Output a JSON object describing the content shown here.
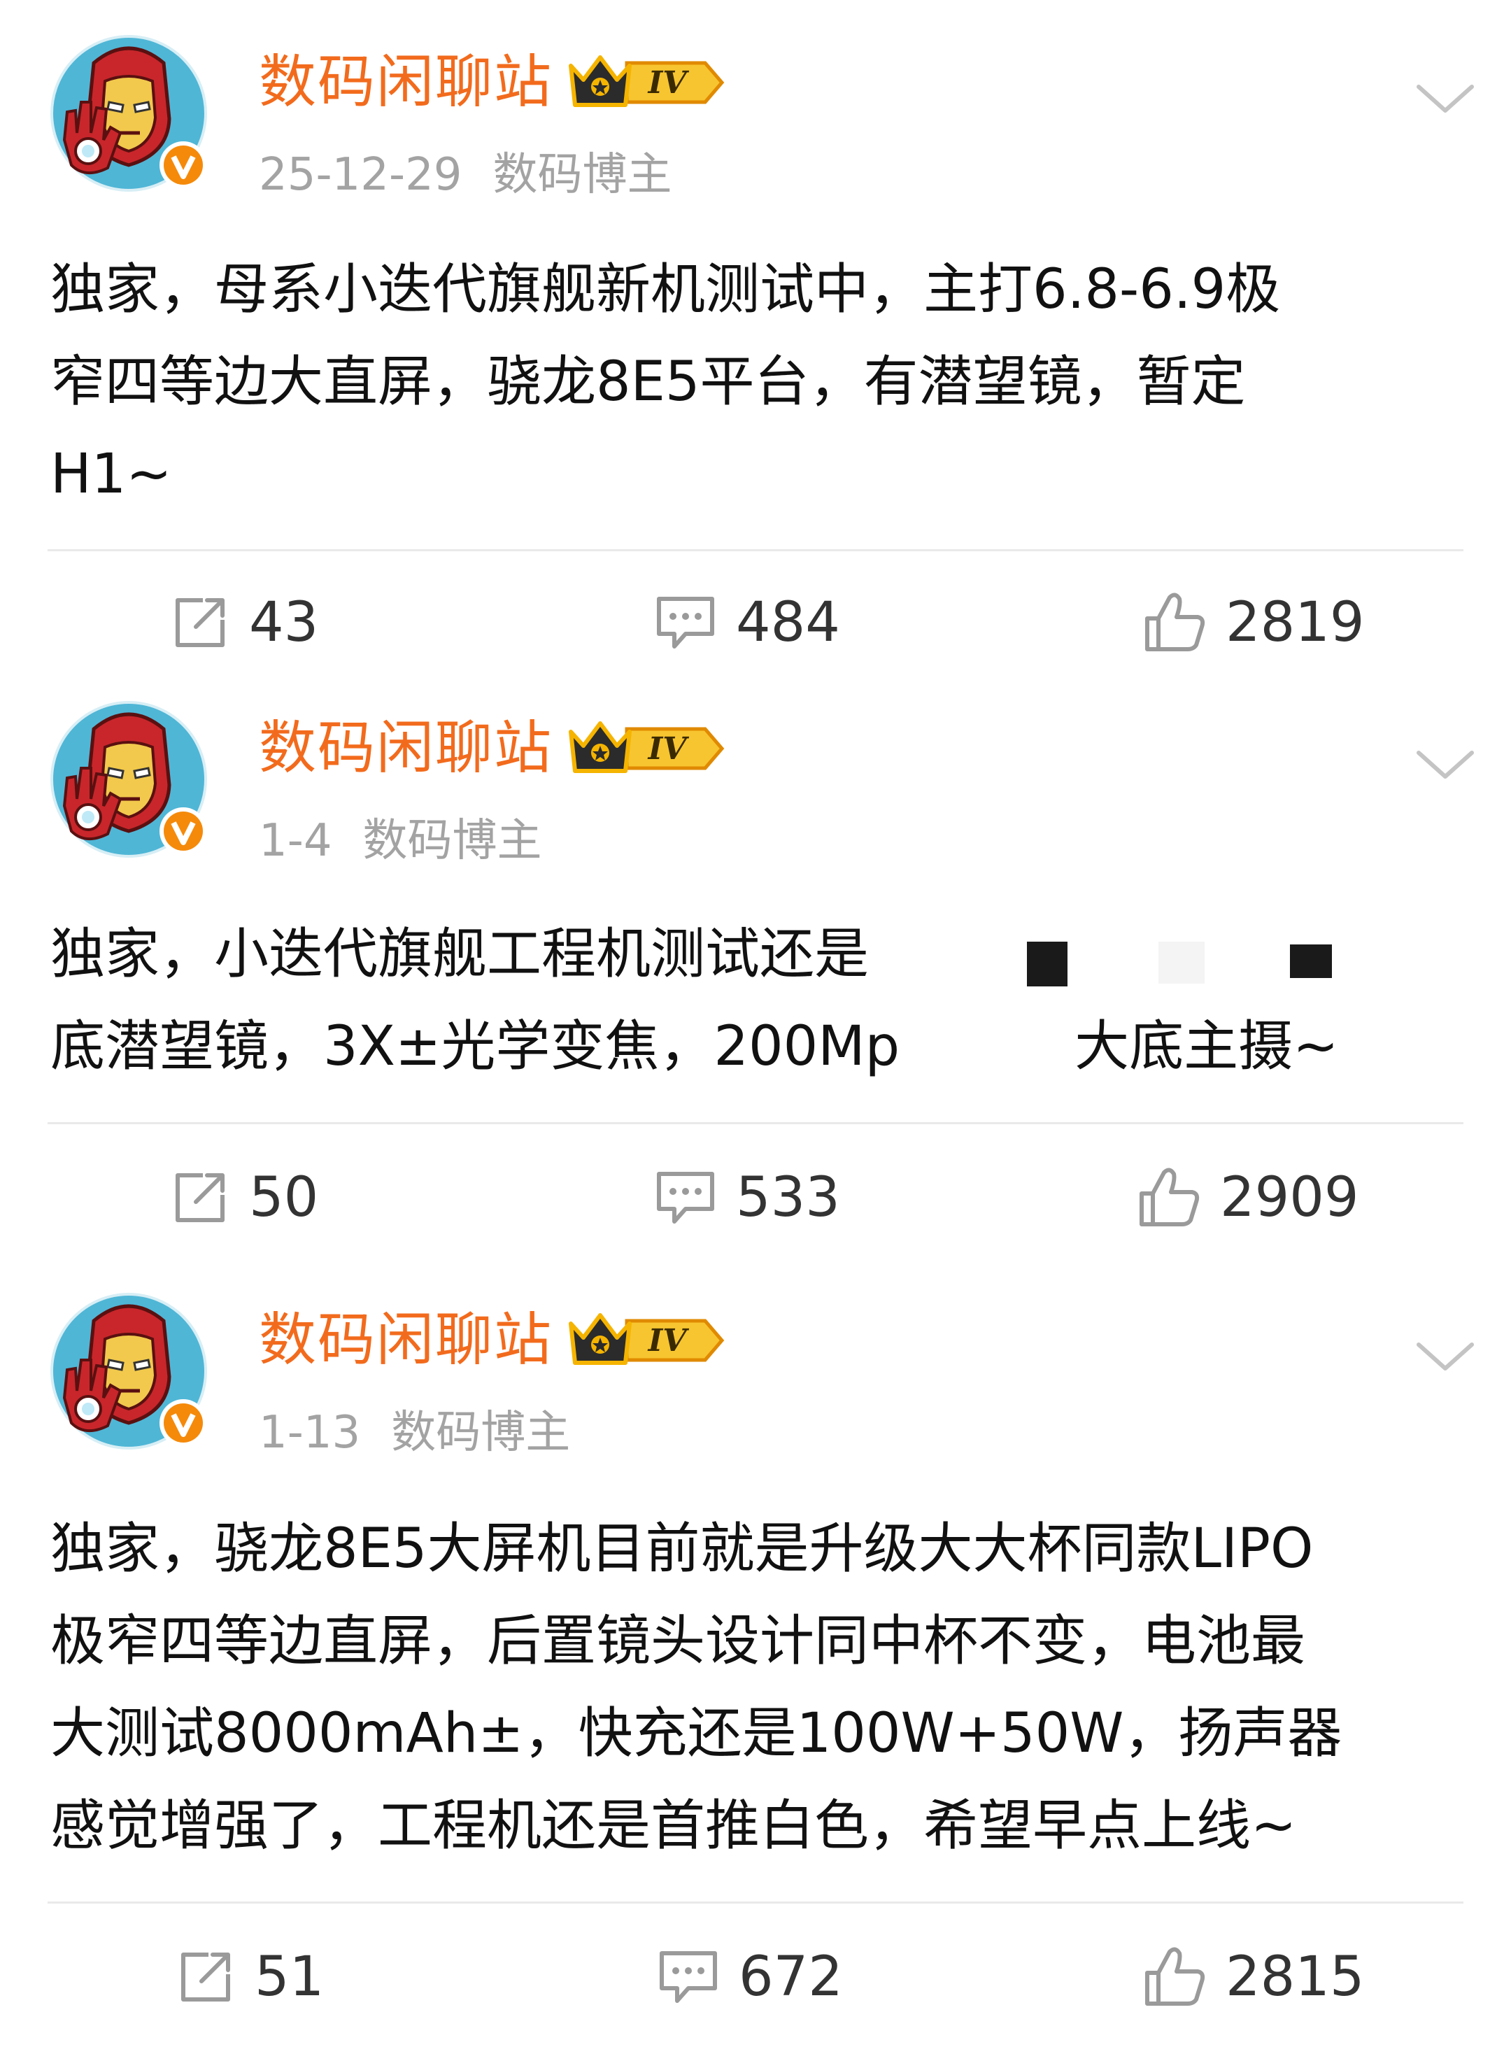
{
  "colors": {
    "author": "#f26b1d",
    "meta": "#a3a3a3",
    "body_text": "#111111",
    "icon": "#9a9a9a",
    "badge_gold": "#f5b400",
    "verify_badge": "#f58a0a"
  },
  "icons": {
    "share": "share-icon",
    "comment": "comment-icon",
    "like": "like-icon",
    "menu": "chevron-down-icon",
    "level": "level-iv-badge",
    "verified": "verified-v-icon"
  },
  "posts": [
    {
      "author": "数码闲聊站",
      "level": "IV",
      "date": "25-12-29",
      "role": "数码博主",
      "lines": [
        "独家，母系小迭代旗舰新机测试中，主打6.8-6.9极",
        "窄四等边大直屏，骁龙8E5平台，有潜望镜，暂定",
        "H1~"
      ],
      "reposts": "43",
      "comments": "484",
      "likes": "2819"
    },
    {
      "author": "数码闲聊站",
      "level": "IV",
      "date": "1-4",
      "role": "数码博主",
      "lines": [
        "独家，小迭代旗舰工程机测试还是",
        "底潜望镜，3X±光学变焦，200Mp"
      ],
      "line2_tail": "大底主摄~",
      "reposts": "50",
      "comments": "533",
      "likes": "2909"
    },
    {
      "author": "数码闲聊站",
      "level": "IV",
      "date": "1-13",
      "role": "数码博主",
      "lines": [
        "独家，骁龙8E5大屏机目前就是升级大大杯同款LIPO",
        "极窄四等边直屏，后置镜头设计同中杯不变，电池最",
        "大测试8000mAh±，快充还是100W+50W，扬声器",
        "感觉增强了，工程机还是首推白色，希望早点上线~"
      ],
      "reposts": "51",
      "comments": "672",
      "likes": "2815"
    }
  ]
}
